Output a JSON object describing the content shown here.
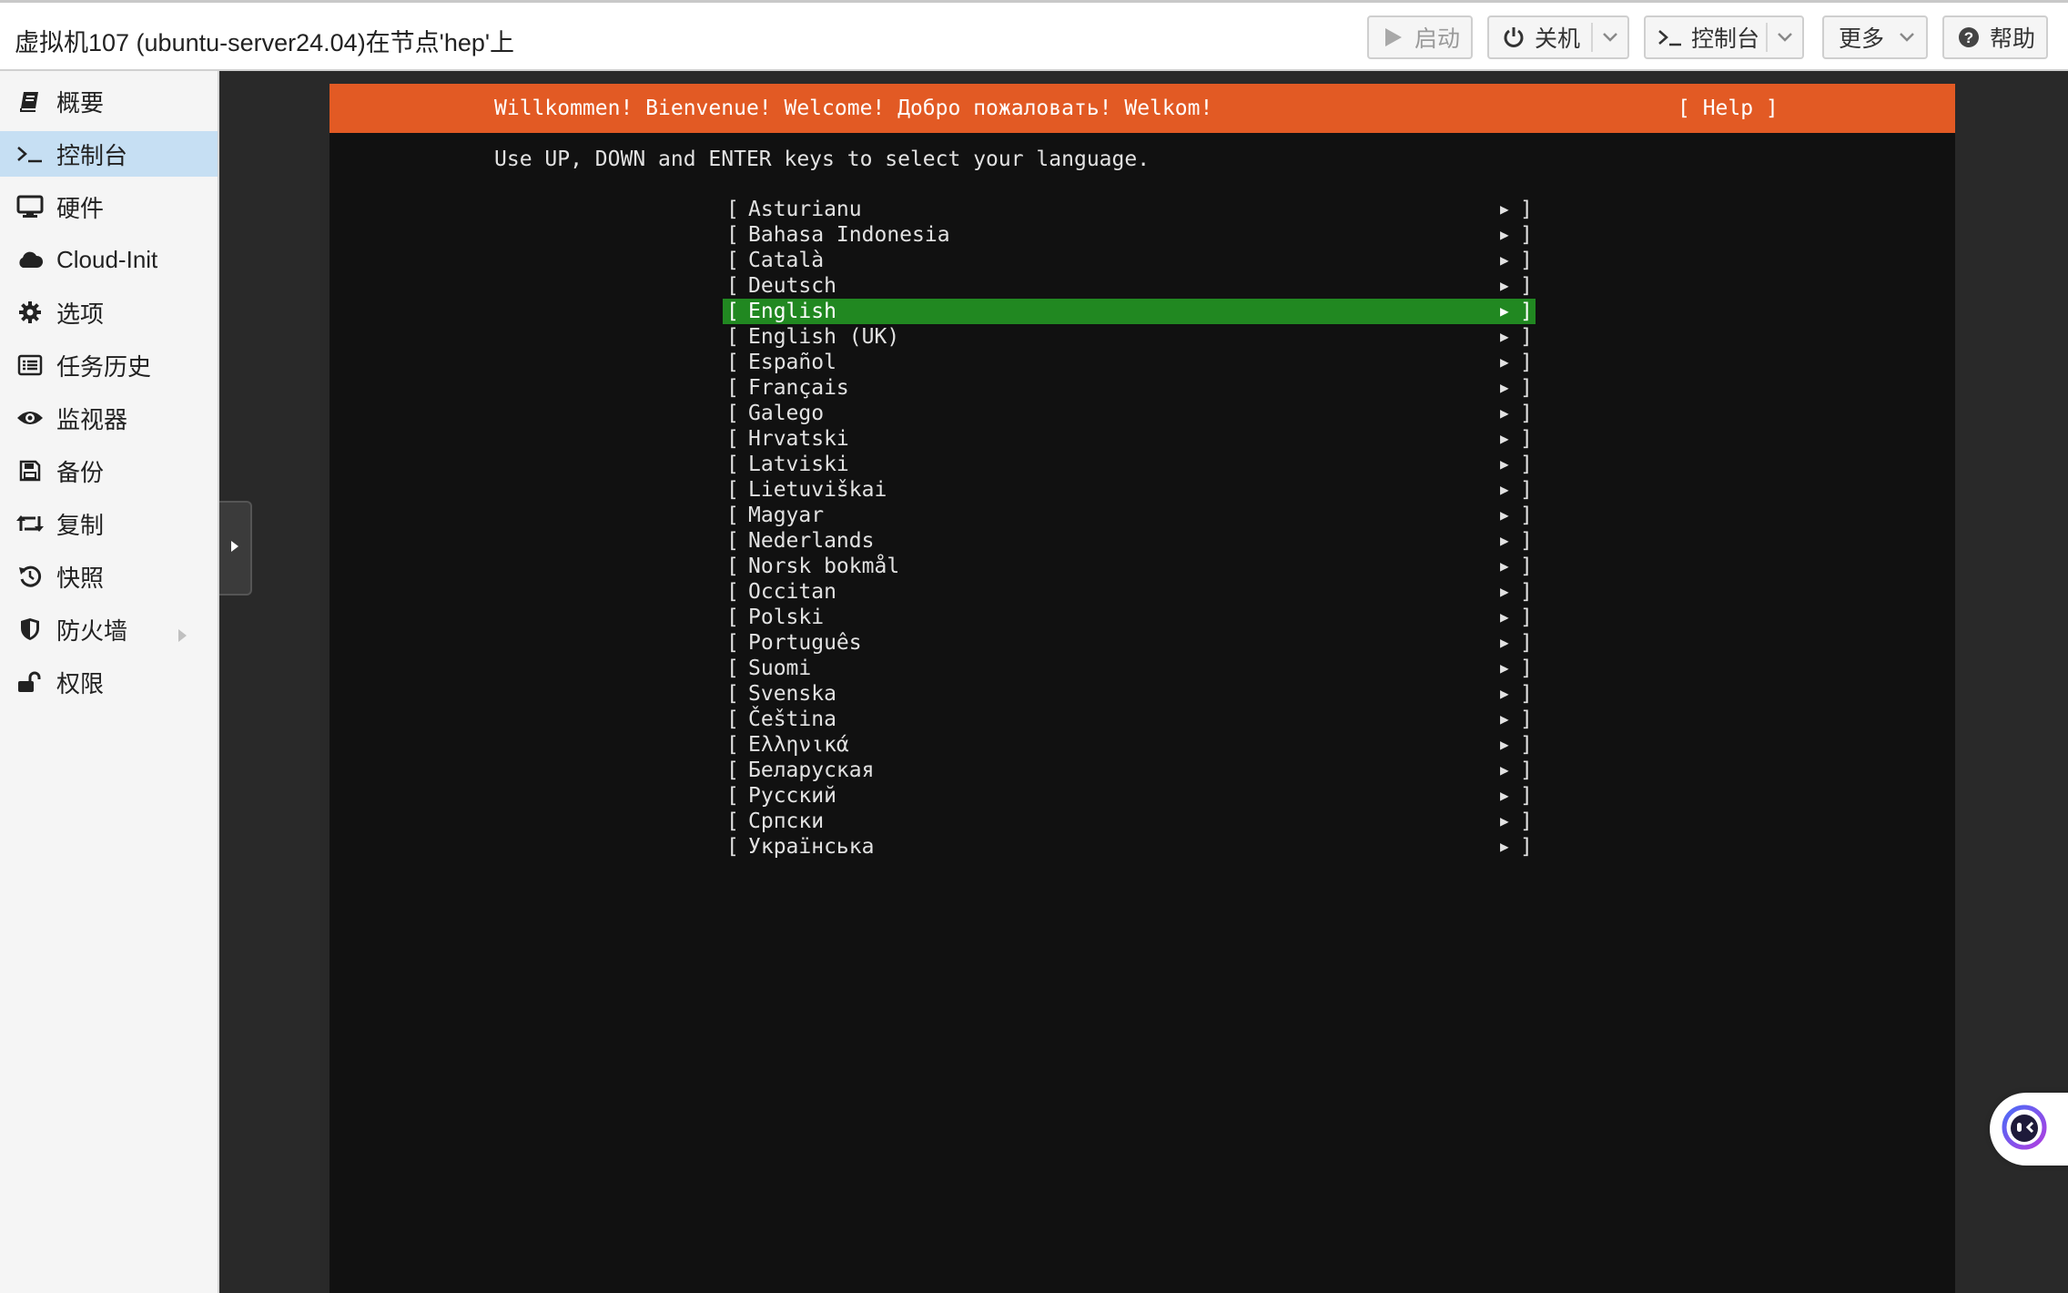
{
  "header": {
    "title": "虚拟机107 (ubuntu-server24.04)在节点'hep'上",
    "buttons": {
      "start": "启动",
      "shutdown": "关机",
      "console": "控制台",
      "more": "更多",
      "help": "帮助"
    }
  },
  "sidebar": {
    "items": [
      {
        "label": "概要",
        "icon": "book-icon"
      },
      {
        "label": "控制台",
        "icon": "terminal-icon",
        "active": true
      },
      {
        "label": "硬件",
        "icon": "desktop-icon"
      },
      {
        "label": "Cloud-Init",
        "icon": "cloud-icon"
      },
      {
        "label": "选项",
        "icon": "gear-icon"
      },
      {
        "label": "任务历史",
        "icon": "list-icon"
      },
      {
        "label": "监视器",
        "icon": "eye-icon"
      },
      {
        "label": "备份",
        "icon": "floppy-icon"
      },
      {
        "label": "复制",
        "icon": "retweet-icon"
      },
      {
        "label": "快照",
        "icon": "history-icon"
      },
      {
        "label": "防火墙",
        "icon": "shield-icon",
        "expandable": true
      },
      {
        "label": "权限",
        "icon": "unlock-icon"
      }
    ]
  },
  "terminal": {
    "welcome": "Willkommen! Bienvenue! Welcome! Добро пожаловать! Welkom!",
    "help": "[ Help ]",
    "instructions": "Use UP, DOWN and ENTER keys to select your language.",
    "languages": [
      "Asturianu",
      "Bahasa Indonesia",
      "Català",
      "Deutsch",
      "English",
      "English (UK)",
      "Español",
      "Français",
      "Galego",
      "Hrvatski",
      "Latviski",
      "Lietuviškai",
      "Magyar",
      "Nederlands",
      "Norsk bokmål",
      "Occitan",
      "Polski",
      "Português",
      "Suomi",
      "Svenska",
      "Čeština",
      "Ελληνικά",
      "Беларуская",
      "Русский",
      "Српски",
      "Українська"
    ],
    "selected_index": 4,
    "bracket_open": "[",
    "bracket_close": "]",
    "arrow": "▶"
  },
  "colors": {
    "header_bar": "#e25a24",
    "selection": "#218821",
    "terminal_bg": "#111111",
    "sidebar_active": "#c6dff3"
  }
}
